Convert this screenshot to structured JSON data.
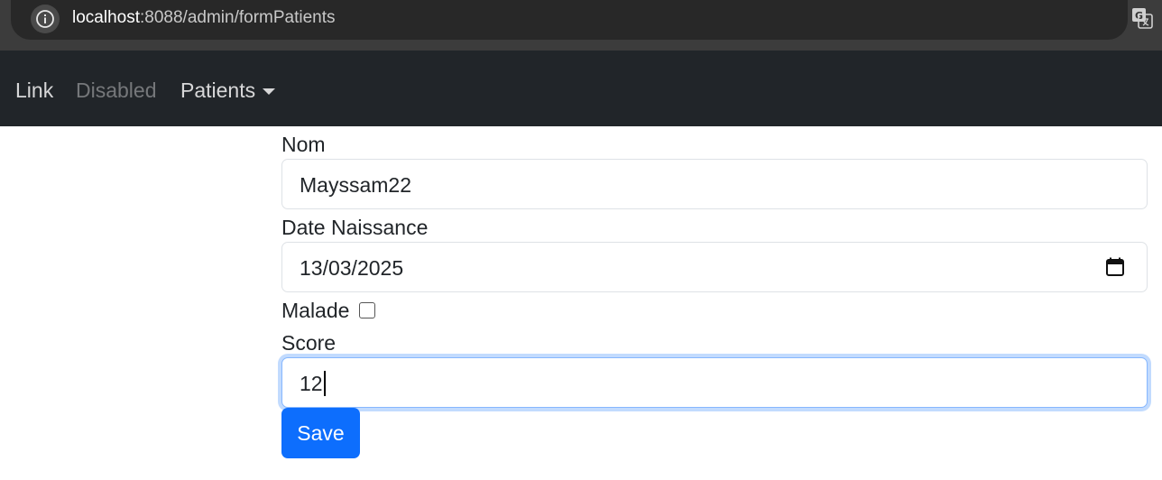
{
  "browser": {
    "url_host": "localhost",
    "url_rest": ":8088/admin/formPatients",
    "icons": {
      "site_info": "info-icon",
      "translate": "translate-icon"
    }
  },
  "navbar": {
    "items": [
      {
        "label": "Link",
        "state": "enabled"
      },
      {
        "label": "Disabled",
        "state": "disabled"
      },
      {
        "label": "Patients",
        "state": "dropdown"
      }
    ]
  },
  "form": {
    "nom": {
      "label": "Nom",
      "value": "Mayssam22"
    },
    "date_naissance": {
      "label": "Date Naissance",
      "value": "13/03/2025"
    },
    "malade": {
      "label": "Malade",
      "checked": false
    },
    "score": {
      "label": "Score",
      "value": "12",
      "focused": true
    },
    "save_label": "Save"
  },
  "colors": {
    "navbar_bg": "#212529",
    "primary": "#0d6efd",
    "focus_ring": "#86b7fe"
  }
}
